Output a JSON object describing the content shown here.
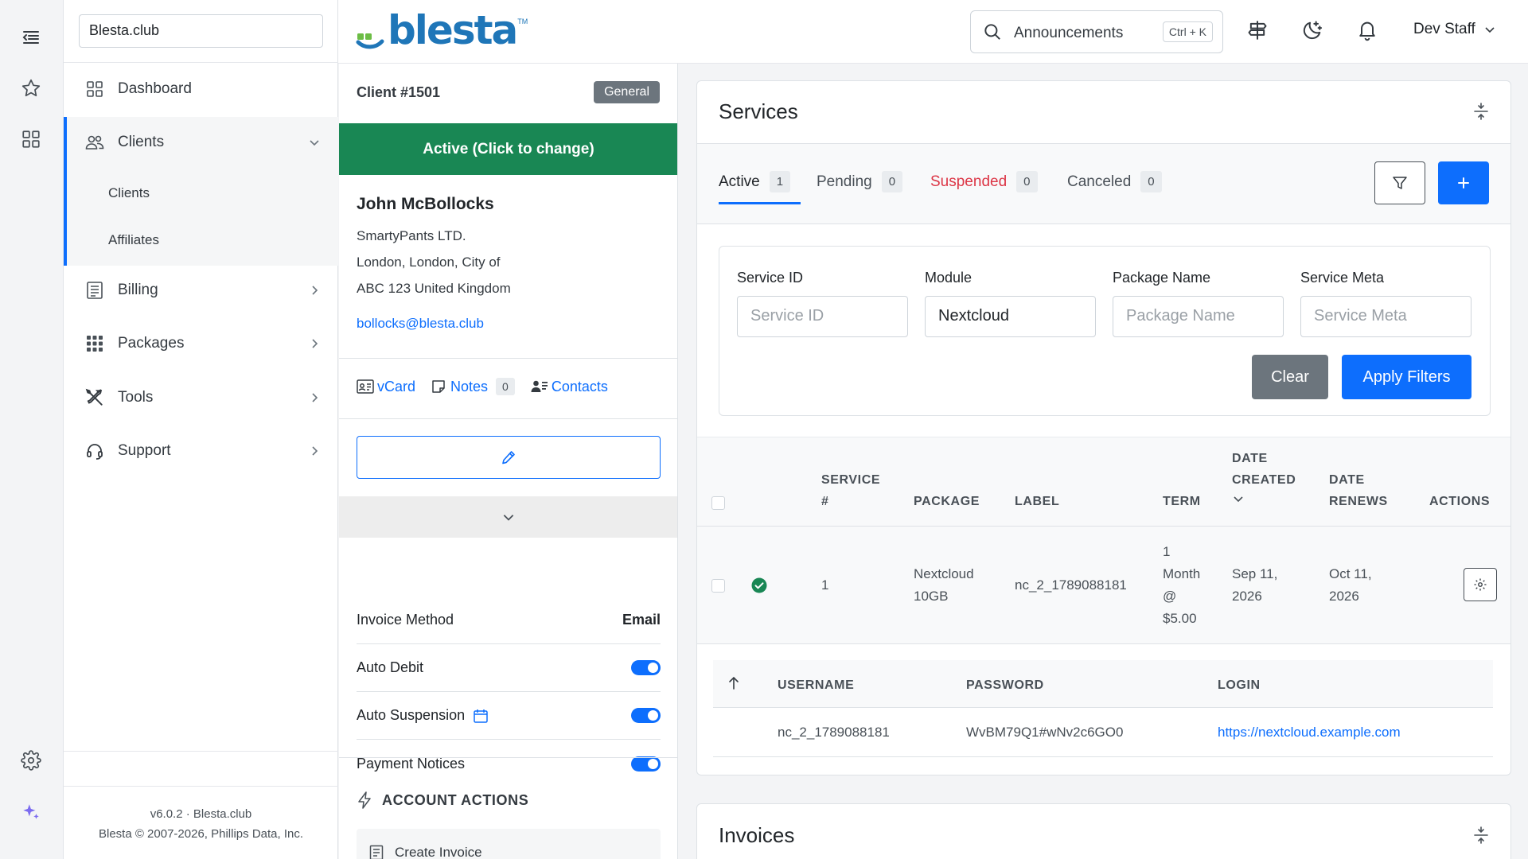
{
  "org": {
    "name": "Blesta.club"
  },
  "logo": {
    "text": "blesta",
    "tm": "TM"
  },
  "search": {
    "label": "Announcements",
    "shortcut": "Ctrl + K"
  },
  "user": {
    "name": "Dev Staff"
  },
  "nav": {
    "dashboard": "Dashboard",
    "clients": "Clients",
    "clients_sub": [
      "Clients",
      "Affiliates"
    ],
    "billing": "Billing",
    "packages": "Packages",
    "tools": "Tools",
    "support": "Support"
  },
  "footer": {
    "version": "v6.0.2 · Blesta.club",
    "copyright": "Blesta © 2007-2026, Phillips Data, Inc."
  },
  "client": {
    "number": "Client #1501",
    "group": "General",
    "status": "Active (Click to change)",
    "name": "John McBollocks",
    "company": "SmartyPants LTD.",
    "city_line": "London, London, City of",
    "zip_line": "ABC 123 United Kingdom",
    "email": "bollocks@blesta.club",
    "links": {
      "vcard": "vCard",
      "notes": "Notes",
      "notes_count": "0",
      "contacts": "Contacts"
    },
    "settings": [
      {
        "label": "Invoice Method",
        "value": "Email"
      },
      {
        "label": "Auto Debit",
        "enabled": true
      },
      {
        "label": "Auto Suspension",
        "enabled": true
      },
      {
        "label": "Payment Notices",
        "enabled": true
      }
    ],
    "account_actions": {
      "title": "ACCOUNT ACTIONS",
      "first": "Create Invoice"
    }
  },
  "services": {
    "title": "Services",
    "tabs": [
      {
        "label": "Active",
        "count": "1"
      },
      {
        "label": "Pending",
        "count": "0"
      },
      {
        "label": "Suspended",
        "count": "0"
      },
      {
        "label": "Canceled",
        "count": "0"
      }
    ],
    "filters": {
      "service_id": {
        "label": "Service ID",
        "placeholder": "Service ID"
      },
      "module": {
        "label": "Module",
        "value": "Nextcloud"
      },
      "package_name": {
        "label": "Package Name",
        "placeholder": "Package Name"
      },
      "service_meta": {
        "label": "Service Meta",
        "placeholder": "Service Meta"
      },
      "clear": "Clear",
      "apply": "Apply Filters"
    },
    "table": {
      "headers": {
        "service_no": [
          "SERVICE",
          "#"
        ],
        "package": "PACKAGE",
        "label": "LABEL",
        "term": "TERM",
        "date_created": [
          "DATE",
          "CREATED"
        ],
        "date_renews": [
          "DATE",
          "RENEWS"
        ],
        "actions": "ACTIONS"
      },
      "rows": [
        {
          "id": "1",
          "package": [
            "Nextcloud",
            "10GB"
          ],
          "label": "nc_2_1789088181",
          "term": [
            "1",
            "Month",
            "@",
            "$5.00"
          ],
          "created": [
            "Sep 11,",
            "2026"
          ],
          "renews": [
            "Oct 11,",
            "2026"
          ]
        }
      ],
      "detail": {
        "headers": {
          "username": "USERNAME",
          "password": "PASSWORD",
          "login": "LOGIN"
        },
        "username": "nc_2_1789088181",
        "password": "WvBM79Q1#wNv2c6GO0",
        "login": "https://nextcloud.example.com"
      }
    }
  },
  "invoices": {
    "title": "Invoices"
  },
  "colors": {
    "primary": "#0d6efd",
    "success": "#198754",
    "danger": "#dc3545",
    "secondary": "#6c757d"
  }
}
